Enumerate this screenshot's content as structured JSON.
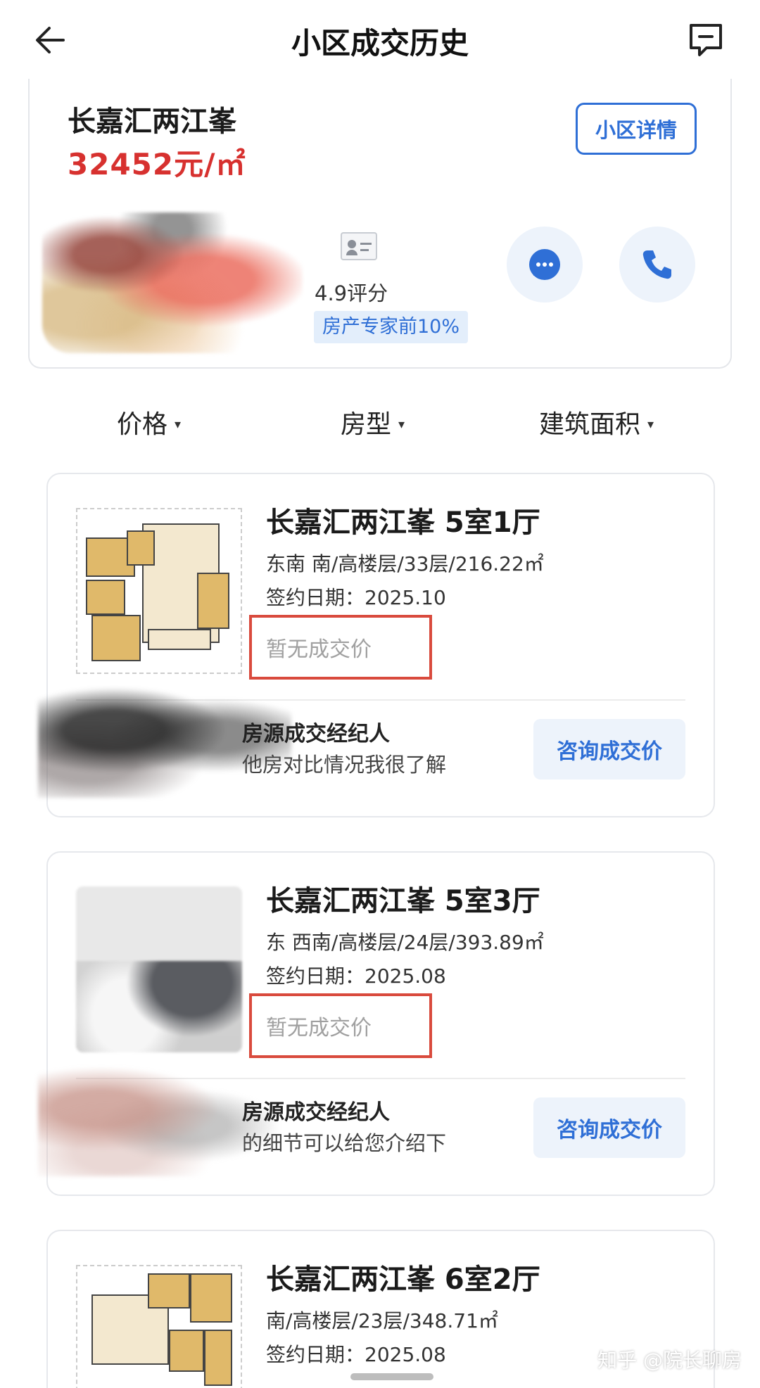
{
  "header": {
    "title": "小区成交历史",
    "back_icon": "arrow-left-icon",
    "feedback_icon": "feedback-chat-icon"
  },
  "community": {
    "name": "长嘉汇两江峯",
    "price": "32452元/㎡",
    "detail_button": "小区详情",
    "agent": {
      "score": "4.9评分",
      "tag": "房产专家前10%"
    }
  },
  "filters": [
    {
      "label": "价格"
    },
    {
      "label": "房型"
    },
    {
      "label": "建筑面积"
    }
  ],
  "listings": [
    {
      "title": "长嘉汇两江峯 5室1厅",
      "info": "东南 南/高楼层/33层/216.22㎡",
      "date": "签约日期：2025.10",
      "price": "暂无成交价",
      "agent_role": "房源成交经纪人",
      "agent_note": "他房对比情况我很了解",
      "consult_button": "咨询成交价"
    },
    {
      "title": "长嘉汇两江峯 5室3厅",
      "info": "东 西南/高楼层/24层/393.89㎡",
      "date": "签约日期：2025.08",
      "price": "暂无成交价",
      "agent_role": "房源成交经纪人",
      "agent_note": "的细节可以给您介绍下",
      "consult_button": "咨询成交价"
    },
    {
      "title": "长嘉汇两江峯 6室2厅",
      "info": "南/高楼层/23层/348.71㎡",
      "date": "签约日期：2025.08"
    }
  ],
  "watermark": "知乎 @院长聊房",
  "colors": {
    "accent_blue": "#2f6fd6",
    "price_red": "#d7312f",
    "highlight_box": "#d94a3d"
  }
}
